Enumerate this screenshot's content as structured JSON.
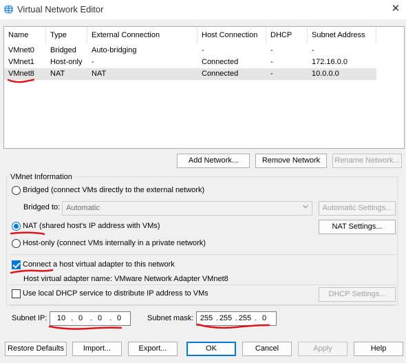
{
  "window": {
    "title": "Virtual Network Editor",
    "close_glyph": "✕",
    "icon": "globe-icon",
    "accent": "#0078d7",
    "annotation_color": "#e0141c"
  },
  "table": {
    "columns": [
      "Name",
      "Type",
      "External Connection",
      "Host Connection",
      "DHCP",
      "Subnet Address"
    ],
    "rows": [
      [
        "VMnet0",
        "Bridged",
        "Auto-bridging",
        "-",
        "-",
        "-"
      ],
      [
        "VMnet1",
        "Host-only",
        "-",
        "Connected",
        "-",
        "172.16.0.0"
      ],
      [
        "VMnet8",
        "NAT",
        "NAT",
        "Connected",
        "-",
        "10.0.0.0"
      ]
    ],
    "selected_row": "VMnet8"
  },
  "network_buttons": {
    "add": "Add Network...",
    "remove": "Remove Network",
    "rename": "Rename Network..."
  },
  "vmnet_info": {
    "title": "VMnet Information",
    "bridged_label": "Bridged (connect VMs directly to the external network)",
    "bridged_to_label": "Bridged to:",
    "bridged_to_value": "Automatic",
    "auto_settings": "Automatic Settings...",
    "nat_label": "NAT (shared host's IP address with VMs)",
    "nat_settings": "NAT Settings...",
    "hostonly_label": "Host-only (connect VMs internally in a private network)",
    "connect_adapter_label": "Connect a host virtual adapter to this network",
    "adapter_name_label": "Host virtual adapter name: VMware Network Adapter VMnet8",
    "dhcp_label": "Use local DHCP service to distribute IP address to VMs",
    "dhcp_settings": "DHCP Settings...",
    "subnet_ip_label": "Subnet IP:",
    "subnet_ip": [
      "10",
      "0",
      "0",
      "0"
    ],
    "subnet_mask_label": "Subnet mask:",
    "subnet_mask": [
      "255",
      "255",
      "255",
      "0"
    ],
    "selected_mode": "NAT",
    "connect_adapter_checked": true,
    "dhcp_checked": false
  },
  "footer": {
    "restore": "Restore Defaults",
    "import": "Import...",
    "export": "Export...",
    "ok": "OK",
    "cancel": "Cancel",
    "apply": "Apply",
    "help": "Help"
  }
}
